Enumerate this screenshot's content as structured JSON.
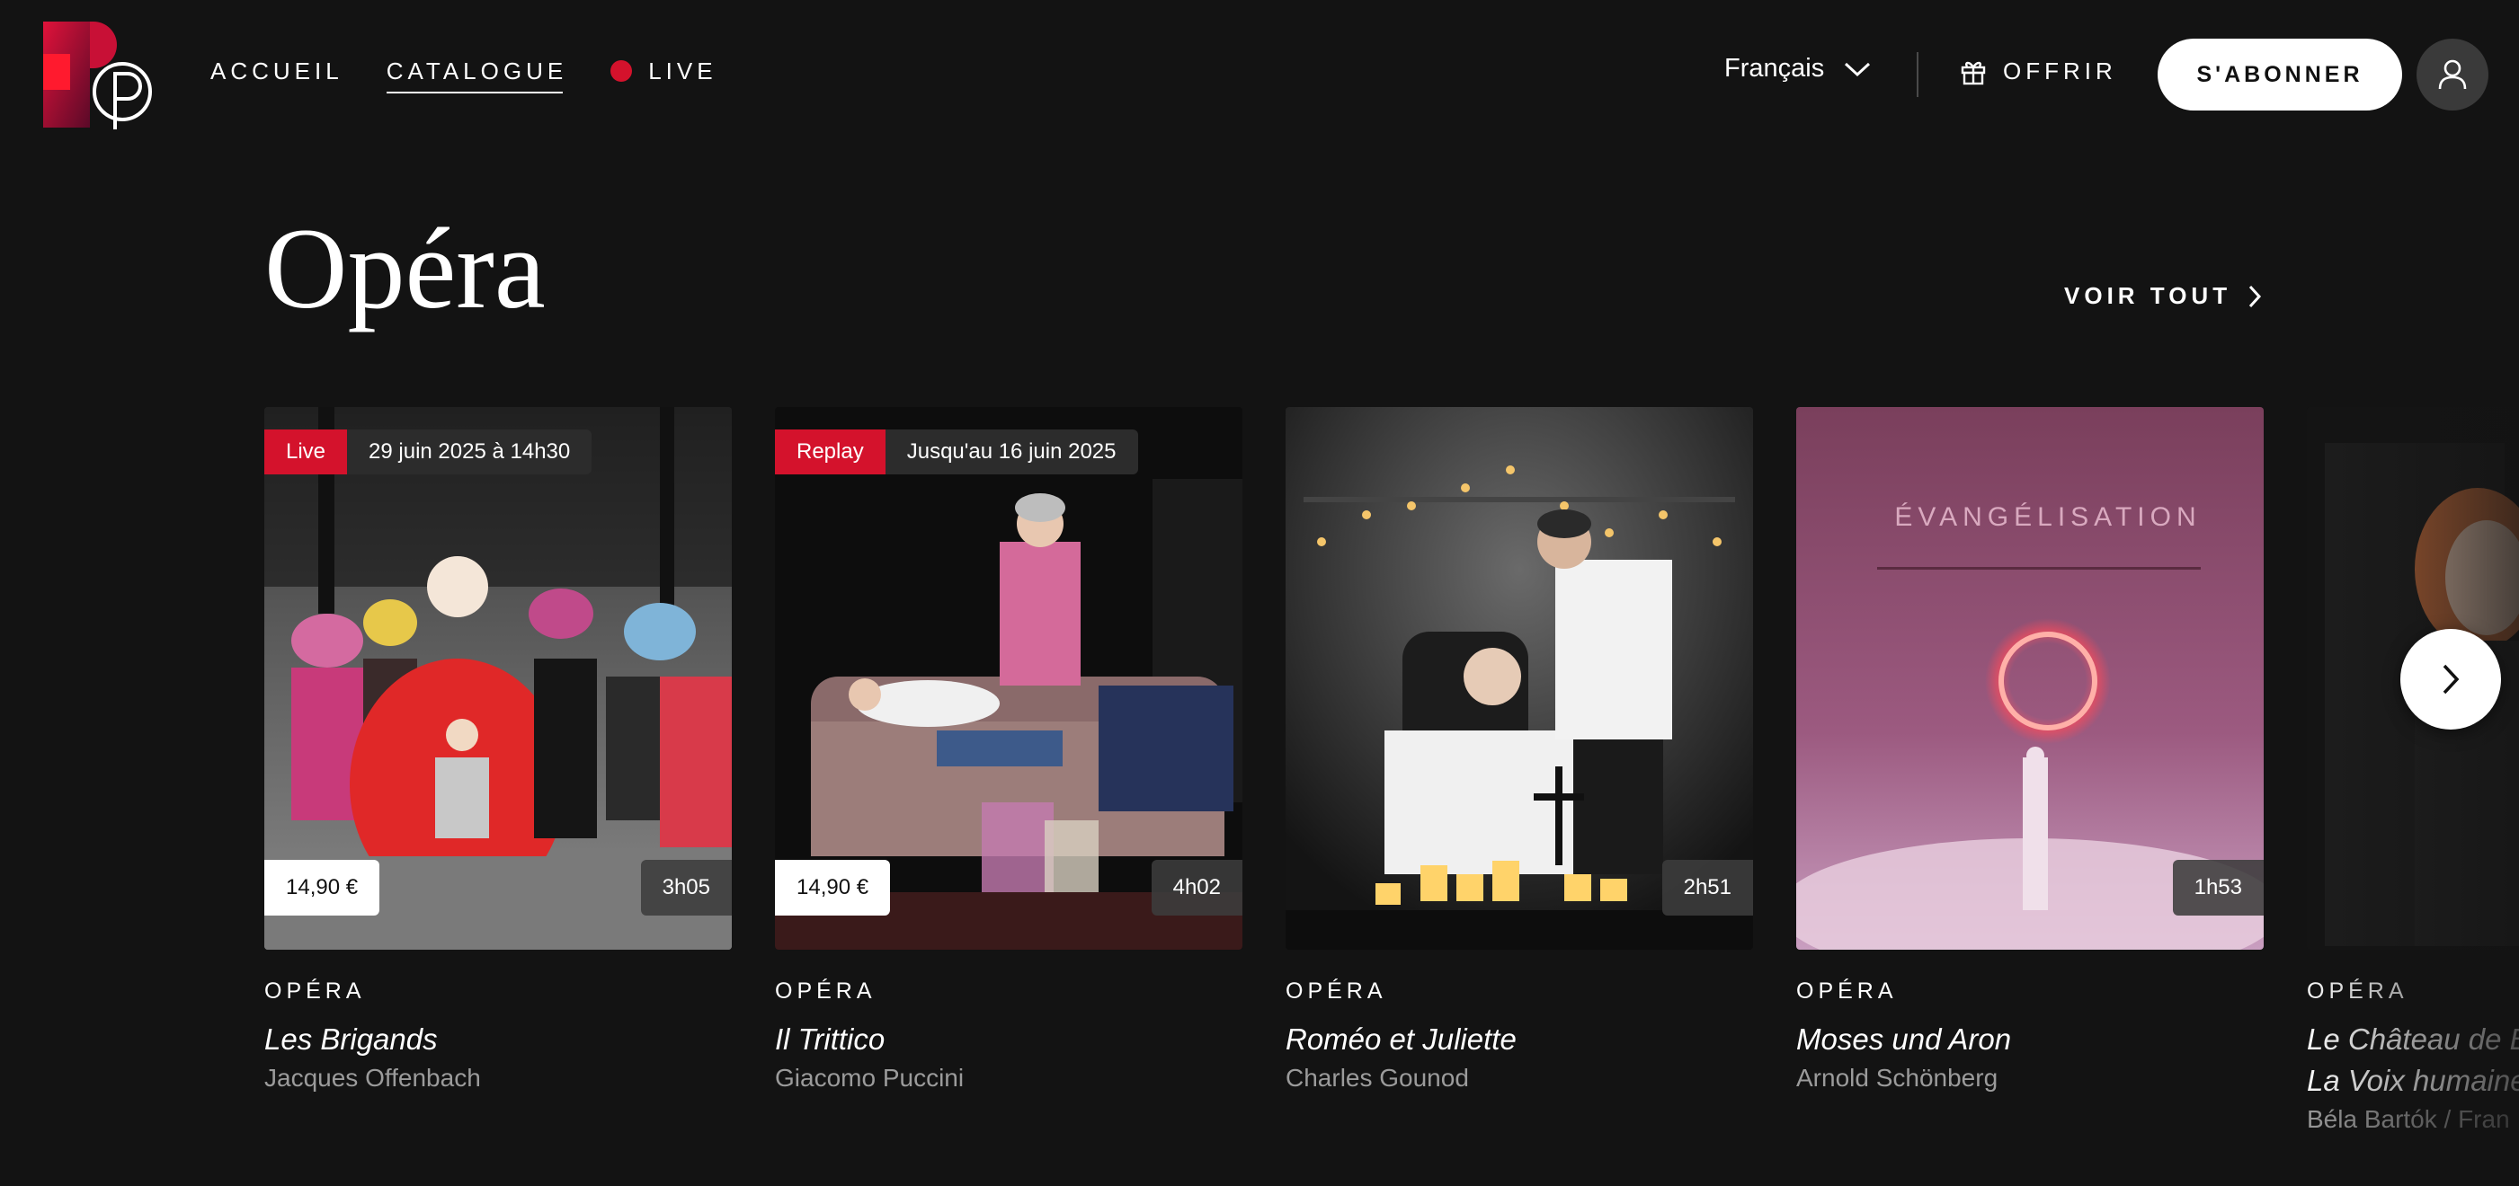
{
  "header": {
    "nav": [
      {
        "label": "ACCUEIL",
        "active": false
      },
      {
        "label": "CATALOGUE",
        "active": true
      },
      {
        "label": "LIVE",
        "active": false
      }
    ],
    "language": "Français",
    "offer_label": "OFFRIR",
    "subscribe_label": "S'ABONNER"
  },
  "section": {
    "title": "Opéra",
    "see_all_label": "VOIR TOUT"
  },
  "cards": [
    {
      "status": "Live",
      "date": "29 juin 2025 à 14h30",
      "price": "14,90 €",
      "duration": "3h05",
      "genre": "OPÉRA",
      "title": "Les Brigands",
      "title_line2": "",
      "composer": "Jacques Offenbach"
    },
    {
      "status": "Replay",
      "date": "Jusqu'au 16 juin 2025",
      "price": "14,90 €",
      "duration": "4h02",
      "genre": "OPÉRA",
      "title": "Il Trittico",
      "title_line2": "",
      "composer": "Giacomo Puccini"
    },
    {
      "status": "",
      "date": "",
      "price": "",
      "duration": "2h51",
      "genre": "OPÉRA",
      "title": "Roméo et Juliette",
      "title_line2": "",
      "composer": "Charles Gounod"
    },
    {
      "status": "",
      "date": "",
      "price": "",
      "duration": "1h53",
      "genre": "OPÉRA",
      "title": "Moses und Aron",
      "title_line2": "",
      "composer": "Arnold Schönberg",
      "image_text": "ÉVANGÉLISATION"
    },
    {
      "status": "",
      "date": "",
      "price": "",
      "duration": "",
      "genre": "OPÉRA",
      "title": "Le Château de B",
      "title_line2": "La Voix humaine",
      "composer": "Béla Bartók / Fran"
    }
  ],
  "colors": {
    "background": "#131313",
    "accent_red": "#d4122c",
    "muted_text": "#9b9b9b"
  },
  "icons": {
    "language_toggle": "chevron-down-icon",
    "offer": "gift-icon",
    "account": "user-icon",
    "see_all": "chevron-right-icon",
    "carousel_next": "chevron-right-icon"
  }
}
